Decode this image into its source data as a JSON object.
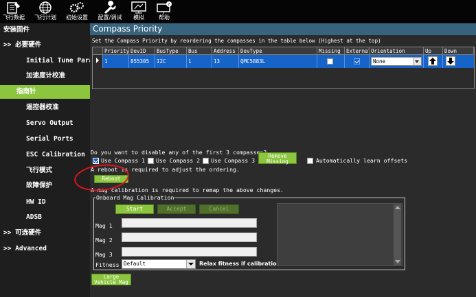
{
  "toolbar": {
    "items": [
      {
        "label": "飞行数据",
        "icon": "flight-data-icon"
      },
      {
        "label": "飞行计划",
        "icon": "globe-icon"
      },
      {
        "label": "初始设置",
        "icon": "gears-icon"
      },
      {
        "label": "配置/调试",
        "icon": "wrench-icon"
      },
      {
        "label": "模拟",
        "icon": "monitor-icon"
      },
      {
        "label": "帮助",
        "icon": "help-monitor-icon"
      }
    ]
  },
  "sidebar": {
    "items": [
      {
        "label": "安装固件"
      },
      {
        "label": ">> 必要硬件"
      },
      {
        "label": "Initial Tune Parameters"
      },
      {
        "label": "加速度计校准"
      },
      {
        "label": "指南针"
      },
      {
        "label": "遥控器校准"
      },
      {
        "label": "Servo Output"
      },
      {
        "label": "Serial Ports"
      },
      {
        "label": "ESC Calibration"
      },
      {
        "label": "飞行模式"
      },
      {
        "label": "故障保护"
      },
      {
        "label": "HW ID"
      },
      {
        "label": "ADSB"
      },
      {
        "label": ">> 可选硬件"
      },
      {
        "label": ">> Advanced"
      }
    ],
    "selected_index": 4
  },
  "main": {
    "title": "Compass Priority",
    "instructions": "Set the Compass Priority by reordering the compasses in the table below (Highest at the top)",
    "grid": {
      "headers": [
        "Priority",
        "DevID",
        "BusType",
        "Bus",
        "Address",
        "DevType",
        "Missing",
        "External",
        "Orientation",
        "Up",
        "Down"
      ],
      "rows": [
        {
          "priority": "1",
          "devid": "855305",
          "bustype": "I2C",
          "bus": "1",
          "address": "13",
          "devtype": "QMC5883L",
          "missing": false,
          "external": true,
          "orientation": "None"
        }
      ]
    },
    "disable_question": "Do you want to disable any of the first 3 compasses?",
    "use_compass": [
      {
        "label": "Use Compass 1",
        "checked": true
      },
      {
        "label": "Use Compass 2",
        "checked": false
      },
      {
        "label": "Use Compass 3",
        "checked": false
      }
    ],
    "remove_missing_label": "Remove Missing",
    "auto_learn": {
      "label": "Automatically learn offsets",
      "checked": false
    },
    "reboot_note": "A reboot is required to adjust the ordering.",
    "reboot_label": "Reboot",
    "mag_cal_note": "A mag calibration is required to remap the above changes.",
    "onboard_cal": {
      "legend": "Onboard Mag Calibration",
      "start_label": "Start",
      "accept_label": "Accept",
      "cancel_label": "Cancel",
      "mags": [
        {
          "label": "Mag 1",
          "value": ""
        },
        {
          "label": "Mag 2",
          "value": ""
        },
        {
          "label": "Mag 3",
          "value": ""
        }
      ],
      "fitness_label": "Fitness",
      "fitness_value": "Default",
      "relax_label": "Relax fitness if calibration fails"
    },
    "large_vehicle_label": "Large Vehicle Mag"
  },
  "colors": {
    "accent_green": "#8cc63f",
    "title_blue": "#37637e",
    "row_selected": "#1764c8",
    "annotation_red": "#e0141c"
  }
}
